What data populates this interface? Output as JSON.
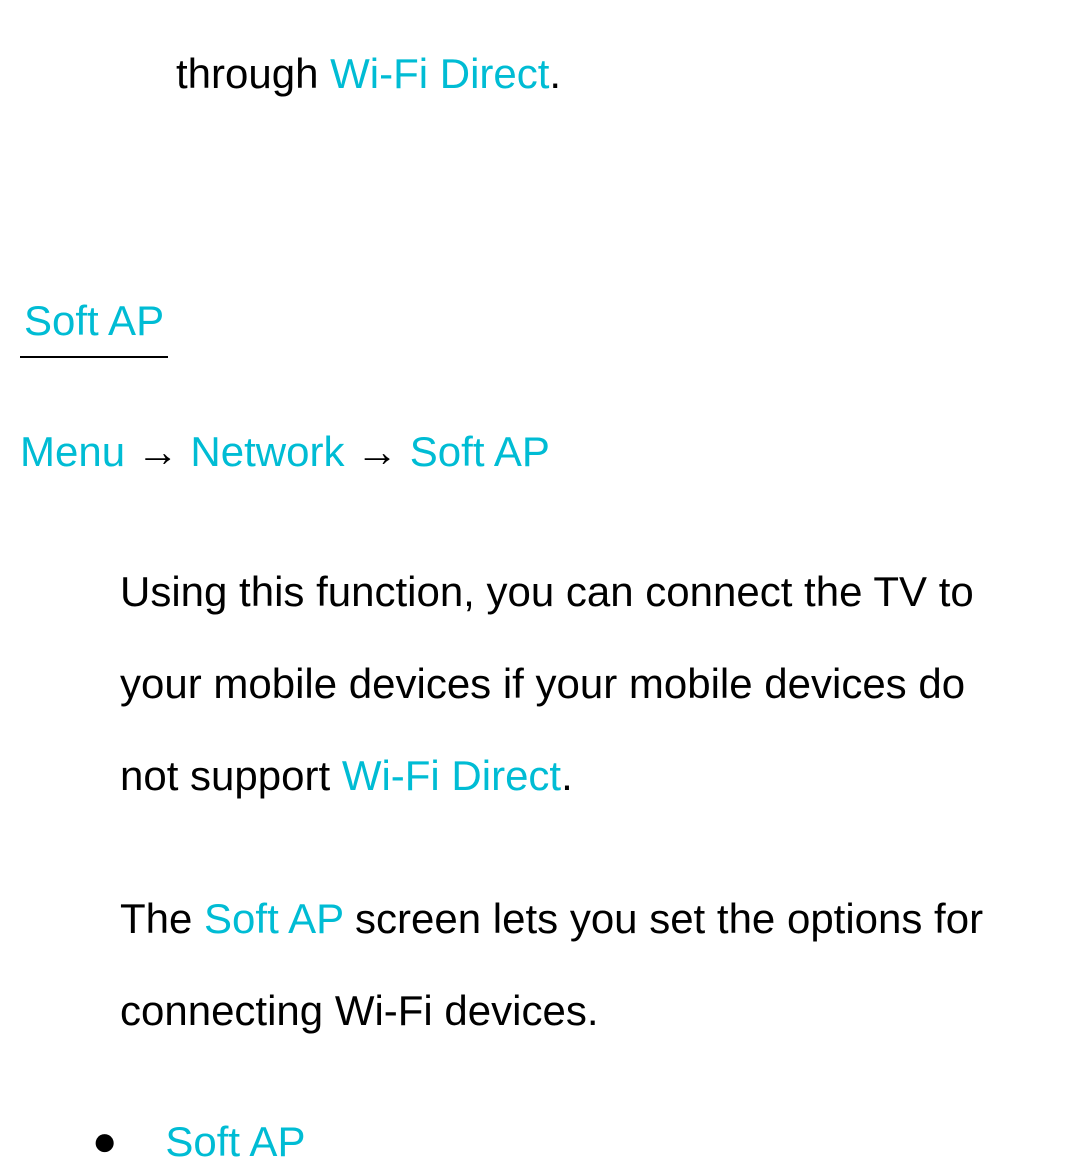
{
  "topFragment": {
    "text1": "through ",
    "link1": "Wi-Fi Direct",
    "text2": "."
  },
  "heading": "Soft AP",
  "breadcrumb": {
    "item1": "Menu",
    "arrow1": " → ",
    "item2": "Network",
    "arrow2": " → ",
    "item3": "Soft AP"
  },
  "para1": {
    "text1": "Using this function, you can connect the TV to your mobile devices if your mobile devices do not support ",
    "link1": "Wi-Fi Direct",
    "text2": "."
  },
  "para2": {
    "text1": "The ",
    "link1": "Soft AP",
    "text2": " screen lets you set the options for connecting Wi-Fi devices."
  },
  "bulletItem": {
    "label": "Soft AP"
  }
}
